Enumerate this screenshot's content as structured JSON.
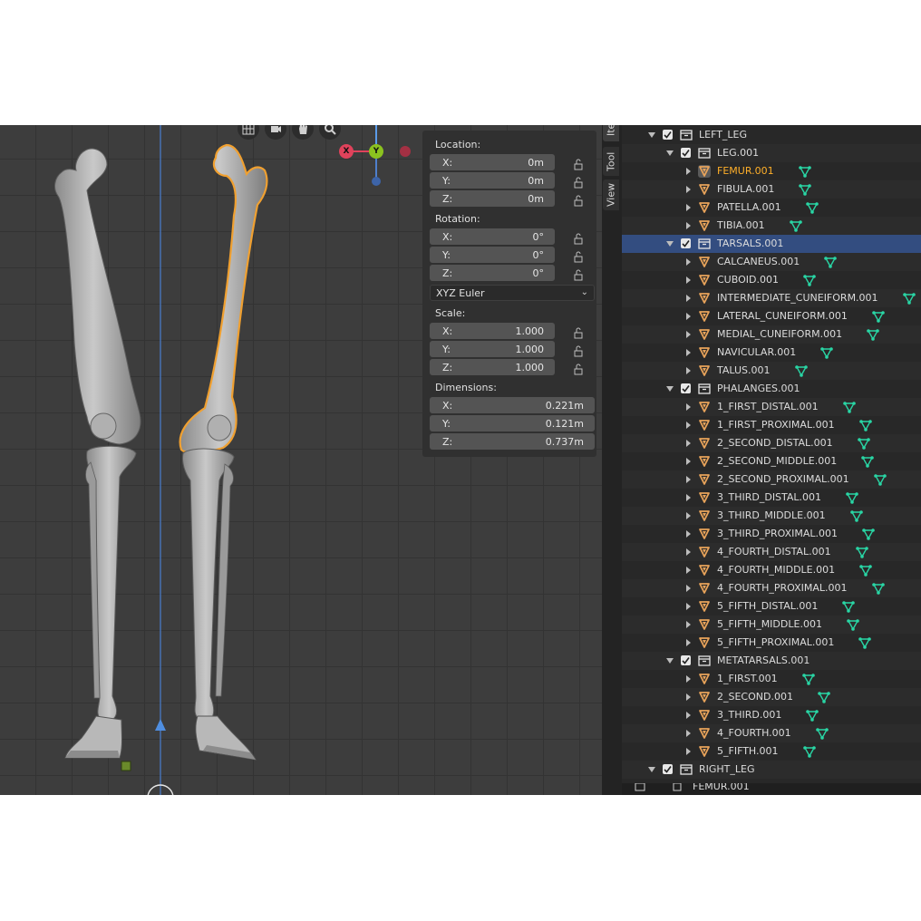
{
  "viewport": {
    "gizmo": {
      "x_label": "X",
      "y_label": "Y"
    }
  },
  "npanel": {
    "location": {
      "label": "Location:",
      "x": {
        "axis": "X:",
        "value": "0m"
      },
      "y": {
        "axis": "Y:",
        "value": "0m"
      },
      "z": {
        "axis": "Z:",
        "value": "0m"
      }
    },
    "rotation": {
      "label": "Rotation:",
      "x": {
        "axis": "X:",
        "value": "0°"
      },
      "y": {
        "axis": "Y:",
        "value": "0°"
      },
      "z": {
        "axis": "Z:",
        "value": "0°"
      },
      "mode": "XYZ Euler"
    },
    "scale": {
      "label": "Scale:",
      "x": {
        "axis": "X:",
        "value": "1.000"
      },
      "y": {
        "axis": "Y:",
        "value": "1.000"
      },
      "z": {
        "axis": "Z:",
        "value": "1.000"
      }
    },
    "dimensions": {
      "label": "Dimensions:",
      "x": {
        "axis": "X:",
        "value": "0.221m"
      },
      "y": {
        "axis": "Y:",
        "value": "0.121m"
      },
      "z": {
        "axis": "Z:",
        "value": "0.737m"
      }
    }
  },
  "tabs": {
    "item": "Item",
    "tool": "Tool",
    "view": "View"
  },
  "outliner": {
    "rows": [
      {
        "label": "LEFT_LEG",
        "type": "collection",
        "depth": 0,
        "expanded": true
      },
      {
        "label": "LEG.001",
        "type": "collection",
        "depth": 1,
        "expanded": true
      },
      {
        "label": "FEMUR.001",
        "type": "mesh",
        "depth": 2,
        "active": true
      },
      {
        "label": "FIBULA.001",
        "type": "mesh",
        "depth": 2
      },
      {
        "label": "PATELLA.001",
        "type": "mesh",
        "depth": 2
      },
      {
        "label": "TIBIA.001",
        "type": "mesh",
        "depth": 2
      },
      {
        "label": "TARSALS.001",
        "type": "collection",
        "depth": 1,
        "expanded": true,
        "selected": true
      },
      {
        "label": "CALCANEUS.001",
        "type": "mesh",
        "depth": 2
      },
      {
        "label": "CUBOID.001",
        "type": "mesh",
        "depth": 2
      },
      {
        "label": "INTERMEDIATE_CUNEIFORM.001",
        "type": "mesh",
        "depth": 2
      },
      {
        "label": "LATERAL_CUNEIFORM.001",
        "type": "mesh",
        "depth": 2
      },
      {
        "label": "MEDIAL_CUNEIFORM.001",
        "type": "mesh",
        "depth": 2
      },
      {
        "label": "NAVICULAR.001",
        "type": "mesh",
        "depth": 2
      },
      {
        "label": "TALUS.001",
        "type": "mesh",
        "depth": 2
      },
      {
        "label": "PHALANGES.001",
        "type": "collection",
        "depth": 1,
        "expanded": true
      },
      {
        "label": "1_FIRST_DISTAL.001",
        "type": "mesh",
        "depth": 2
      },
      {
        "label": "1_FIRST_PROXIMAL.001",
        "type": "mesh",
        "depth": 2
      },
      {
        "label": "2_SECOND_DISTAL.001",
        "type": "mesh",
        "depth": 2
      },
      {
        "label": "2_SECOND_MIDDLE.001",
        "type": "mesh",
        "depth": 2
      },
      {
        "label": "2_SECOND_PROXIMAL.001",
        "type": "mesh",
        "depth": 2
      },
      {
        "label": "3_THIRD_DISTAL.001",
        "type": "mesh",
        "depth": 2
      },
      {
        "label": "3_THIRD_MIDDLE.001",
        "type": "mesh",
        "depth": 2
      },
      {
        "label": "3_THIRD_PROXIMAL.001",
        "type": "mesh",
        "depth": 2
      },
      {
        "label": "4_FOURTH_DISTAL.001",
        "type": "mesh",
        "depth": 2
      },
      {
        "label": "4_FOURTH_MIDDLE.001",
        "type": "mesh",
        "depth": 2
      },
      {
        "label": "4_FOURTH_PROXIMAL.001",
        "type": "mesh",
        "depth": 2
      },
      {
        "label": "5_FIFTH_DISTAL.001",
        "type": "mesh",
        "depth": 2
      },
      {
        "label": "5_FIFTH_MIDDLE.001",
        "type": "mesh",
        "depth": 2
      },
      {
        "label": "5_FIFTH_PROXIMAL.001",
        "type": "mesh",
        "depth": 2
      },
      {
        "label": "METATARSALS.001",
        "type": "collection",
        "depth": 1,
        "expanded": true
      },
      {
        "label": "1_FIRST.001",
        "type": "mesh",
        "depth": 2
      },
      {
        "label": "2_SECOND.001",
        "type": "mesh",
        "depth": 2
      },
      {
        "label": "3_THIRD.001",
        "type": "mesh",
        "depth": 2
      },
      {
        "label": "4_FOURTH.001",
        "type": "mesh",
        "depth": 2
      },
      {
        "label": "5_FIFTH.001",
        "type": "mesh",
        "depth": 2
      },
      {
        "label": "RIGHT_LEG",
        "type": "collection",
        "depth": 0,
        "expanded": true
      }
    ],
    "bottom_label": "FEMUR.001"
  },
  "colors": {
    "accent_selected": "#334d80",
    "active_text": "#ffaf29",
    "mesh_icon": "#e8a35a",
    "modifier_icon": "#29d6a5",
    "selection_outline": "#f0a030"
  }
}
